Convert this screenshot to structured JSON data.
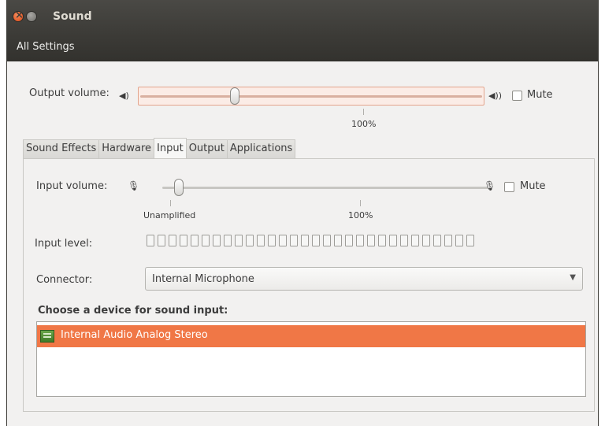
{
  "window": {
    "title": "Sound"
  },
  "toolbar": {
    "all_settings_label": "All Settings"
  },
  "output": {
    "label": "Output volume:",
    "volume_level": 0.28,
    "tick_label": "100%",
    "mute_label": "Mute",
    "muted": false
  },
  "tabs": [
    {
      "label": "Sound Effects",
      "active": false
    },
    {
      "label": "Hardware",
      "active": false
    },
    {
      "label": "Input",
      "active": true
    },
    {
      "label": "Output",
      "active": false
    },
    {
      "label": "Applications",
      "active": false
    }
  ],
  "input": {
    "volume_label": "Input volume:",
    "volume_level": 0.1,
    "tick_unamplified": "Unamplified",
    "tick_100": "100%",
    "mute_label": "Mute",
    "muted": false,
    "level_label": "Input level:",
    "level_bar_count": 30,
    "connector_label": "Connector:",
    "connector_value": "Internal Microphone",
    "device_heading": "Choose a device for sound input:",
    "devices": [
      {
        "name": "Internal Audio Analog Stereo",
        "selected": true
      }
    ]
  },
  "colors": {
    "selection": "#f07746",
    "titlebar": "#3c3b37"
  }
}
